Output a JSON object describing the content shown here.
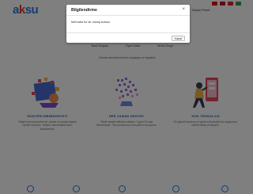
{
  "header": {
    "logo_part_a": "a",
    "logo_part_k": "k",
    "logo_part_su": "su",
    "flag_colors": [
      "#e30a17",
      "#c8102e",
      "#d52b1e",
      "#3a9a3c"
    ],
    "nav": [
      "Anasayfa",
      "Kurumsal",
      "Hizmetler",
      "Referanslar",
      "Blog",
      "İletişim",
      "Sepet",
      "Müşteri Paneli"
    ]
  },
  "hero": {
    "links": [
      "Tescil Sorgula",
      "Fiyat Listesi",
      "Whois Sorgu"
    ],
    "note": "Domain adresinizi hemen sorgulayın ve kaydedin"
  },
  "features": [
    {
      "title": "MÜŞTERİ MEMNUNİYETİ",
      "desc": "Müşteri memnuniyetini her zaman ön planda tutarak hizmet veriyoruz. Sizlerin memnuniyeti bizim başarımızdır."
    },
    {
      "title": "HER ZAMAN DESTEK",
      "desc": "Teknik destek ekibimiz haftanın 7 günü 24 saat hizmetinizde. Tüm sorularınıza hızlı çözüm sunuyoruz."
    },
    {
      "title": "SON TEKNOLOJİ",
      "desc": "En güncel donanım ve yazılım teknolojileri ile altyapımızı sürekli olarak yeniliyoruz."
    }
  ],
  "modal": {
    "title": "Bilgilendirme",
    "close_symbol": "×",
    "message": "Merhaba bu bir mesaj kutusu",
    "button_label": "Kapat"
  },
  "colors": {
    "accent_blue": "#2b7bd8",
    "accent_red": "#e23b2f",
    "feature_title": "#2a5fa8",
    "overlay": "rgba(0,0,0,0.5)"
  }
}
